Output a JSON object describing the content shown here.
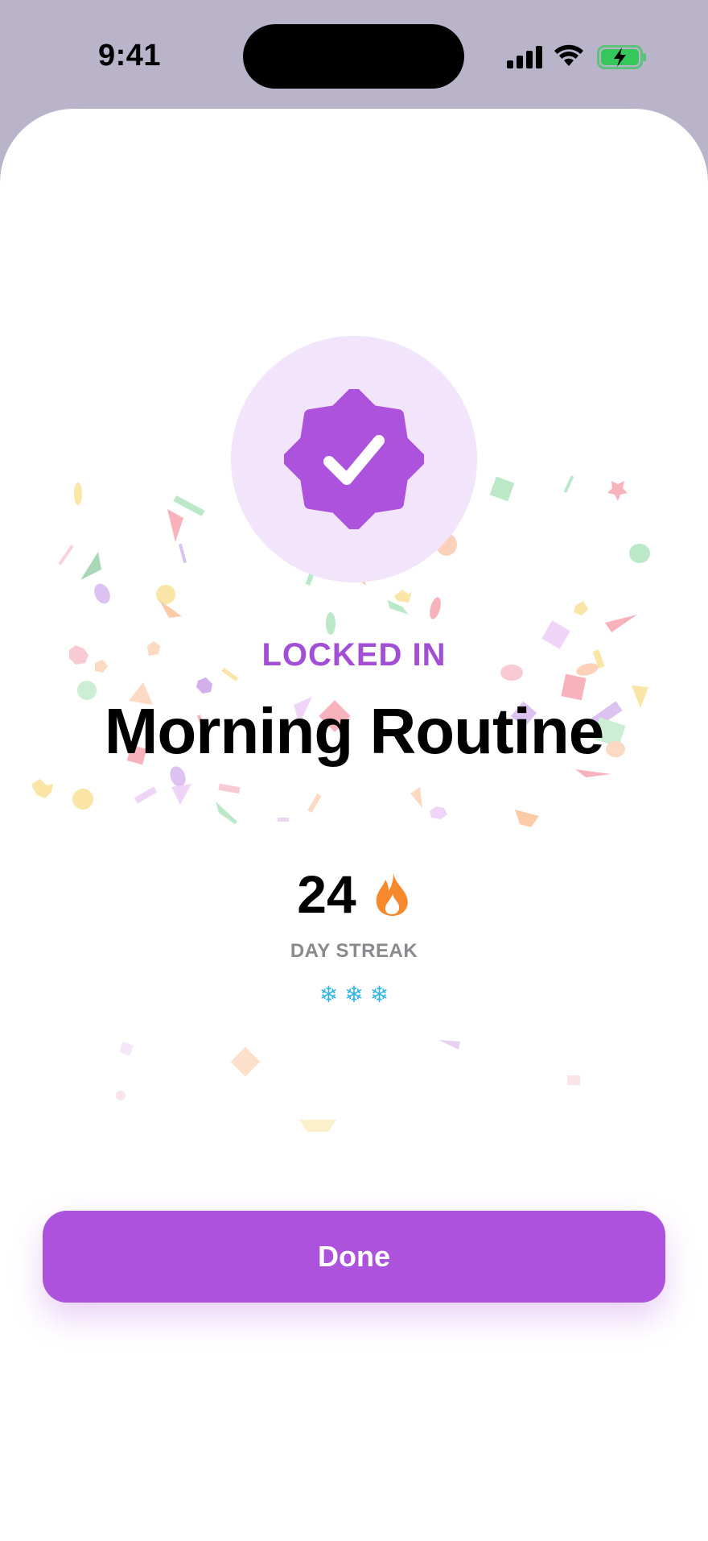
{
  "status_bar": {
    "time": "9:41",
    "icons": [
      "signal-icon",
      "wifi-icon",
      "battery-charging-icon"
    ]
  },
  "badge": {
    "icon": "verified-badge-check-icon",
    "accent_color": "#ad52dc",
    "background_color": "#f2e4fa"
  },
  "completion": {
    "eyebrow": "LOCKED IN",
    "habit_title": "Morning Routine"
  },
  "streak": {
    "count": "24",
    "icon": "flame-icon",
    "label": "DAY STREAK",
    "freezes": [
      "❄",
      "❄",
      "❄"
    ]
  },
  "actions": {
    "done_label": "Done",
    "done_color": "#ad52dc"
  },
  "colors": {
    "backdrop": "#b9b4c9",
    "flame": "#f6892c",
    "snowflake": "#34b4e4"
  }
}
